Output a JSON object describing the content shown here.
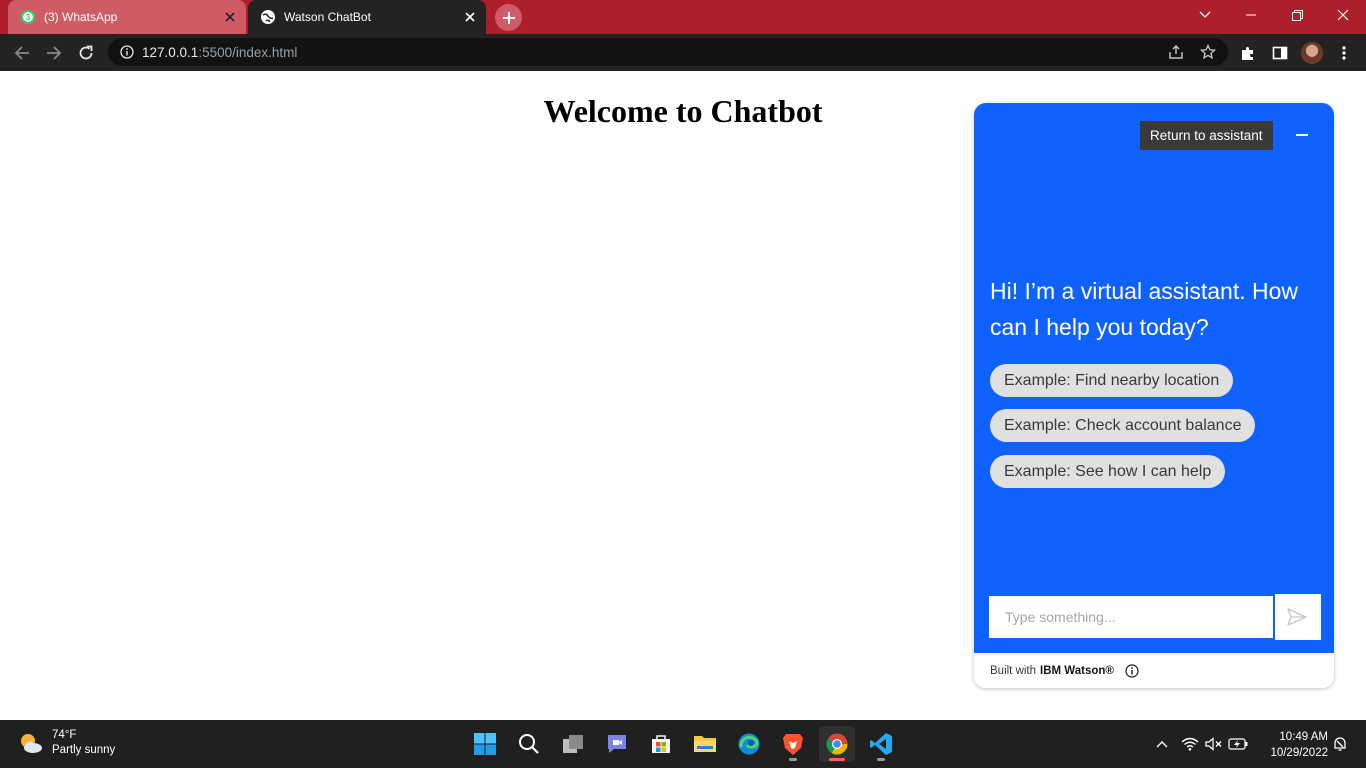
{
  "browser": {
    "tabs": [
      {
        "title": "(3) WhatsApp",
        "active": false,
        "icon": "whatsapp-icon",
        "badge": "3"
      },
      {
        "title": "Watson ChatBot",
        "active": true,
        "icon": "globe-icon"
      }
    ],
    "address": {
      "host": "127.0.0.1",
      "path": ":5500/index.html"
    },
    "colors": {
      "frame": "#ad1f2b",
      "toolbar": "#232323"
    }
  },
  "page": {
    "title": "Welcome to Chatbot"
  },
  "chat": {
    "return_label": "Return to assistant",
    "greeting": "Hi! I’m a virtual assistant. How can I help you today?",
    "suggestions": [
      "Example: Find nearby location",
      "Example: Check account balance",
      "Example: See how I can help"
    ],
    "input_placeholder": "Type something...",
    "footer_prefix": "Built with",
    "footer_brand": "IBM Watson®",
    "colors": {
      "accent": "#0f62fe",
      "chip": "#e0e0e0",
      "button": "#393939"
    }
  },
  "taskbar": {
    "weather_temp": "74°F",
    "weather_desc": "Partly sunny",
    "apps": [
      "windows-start-icon",
      "search-icon",
      "task-view-icon",
      "chat-icon",
      "store-icon",
      "file-explorer-icon",
      "edge-icon",
      "brave-icon",
      "chrome-icon",
      "vscode-icon"
    ],
    "time": "10:49 AM",
    "date": "10/29/2022"
  }
}
